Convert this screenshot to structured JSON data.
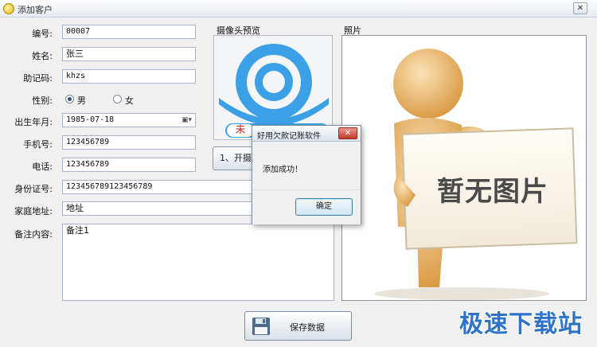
{
  "window": {
    "title": "添加客户"
  },
  "form": {
    "code_label": "编号:",
    "code_value": "00007",
    "name_label": "姓名:",
    "name_value": "张三",
    "mnemonic_label": "助记码:",
    "mnemonic_value": "khzs",
    "gender_label": "性别:",
    "gender_male": "男",
    "gender_female": "女",
    "gender_selected": "男",
    "birth_label": "出生年月:",
    "birth_value": "1985-07-18",
    "mobile_label": "手机号:",
    "mobile_value": "123456789",
    "phone_label": "电话:",
    "phone_value": "123456789",
    "id_label": "身份证号:",
    "id_value": "123456789123456789",
    "address_label": "家庭地址:",
    "address_value": "地址",
    "note_label": "备注内容:",
    "note_value": "备注1"
  },
  "camera": {
    "title": "摄像头预览",
    "status_char": "未",
    "open_button": "1、开摄像头"
  },
  "photo": {
    "title": "照片",
    "placeholder_text": "暂无图片"
  },
  "dialog": {
    "title": "好用欠款记账软件",
    "close": "✕",
    "message": "添加成功！",
    "ok_button": "确定"
  },
  "footer": {
    "save_button": "保存数据"
  },
  "watermark": {
    "text": "极速下载站"
  },
  "colors": {
    "accent": "#2e73c8",
    "camera_blue": "#3ba0e6",
    "figure": "#e3a857"
  }
}
